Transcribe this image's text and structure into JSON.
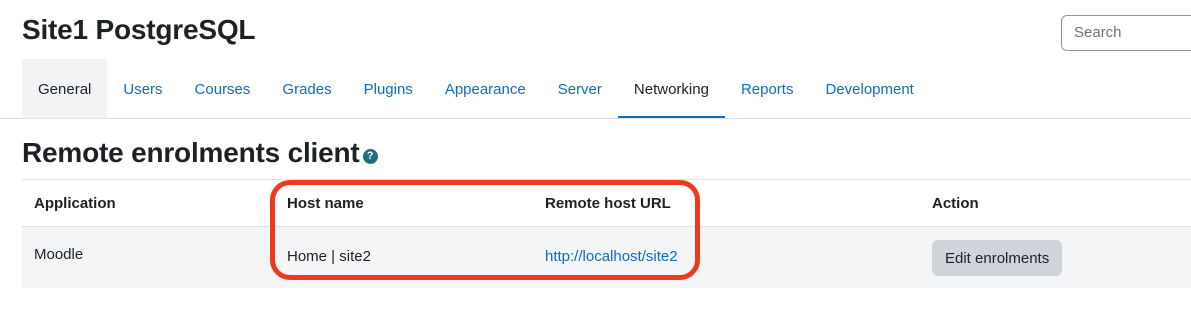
{
  "header": {
    "site_title": "Site1 PostgreSQL",
    "search_placeholder": "Search"
  },
  "tabs": [
    {
      "label": "General",
      "state": "selected"
    },
    {
      "label": "Users"
    },
    {
      "label": "Courses"
    },
    {
      "label": "Grades"
    },
    {
      "label": "Plugins"
    },
    {
      "label": "Appearance"
    },
    {
      "label": "Server"
    },
    {
      "label": "Networking",
      "state": "active"
    },
    {
      "label": "Reports"
    },
    {
      "label": "Development"
    }
  ],
  "page": {
    "heading": "Remote enrolments client",
    "help_icon_glyph": "?"
  },
  "table": {
    "columns": [
      "Application",
      "Host name",
      "Remote host URL",
      "Action"
    ],
    "rows": [
      {
        "application": "Moodle",
        "host_name": "Home | site2",
        "remote_host_url": "http://localhost/site2",
        "action_label": "Edit enrolments"
      }
    ]
  },
  "annotation": {
    "highlight_color": "#ec3a1f"
  },
  "colors": {
    "link": "#0f6cbf",
    "active_tab_underline": "#0f6cbf",
    "button_bg": "#ced4da"
  }
}
